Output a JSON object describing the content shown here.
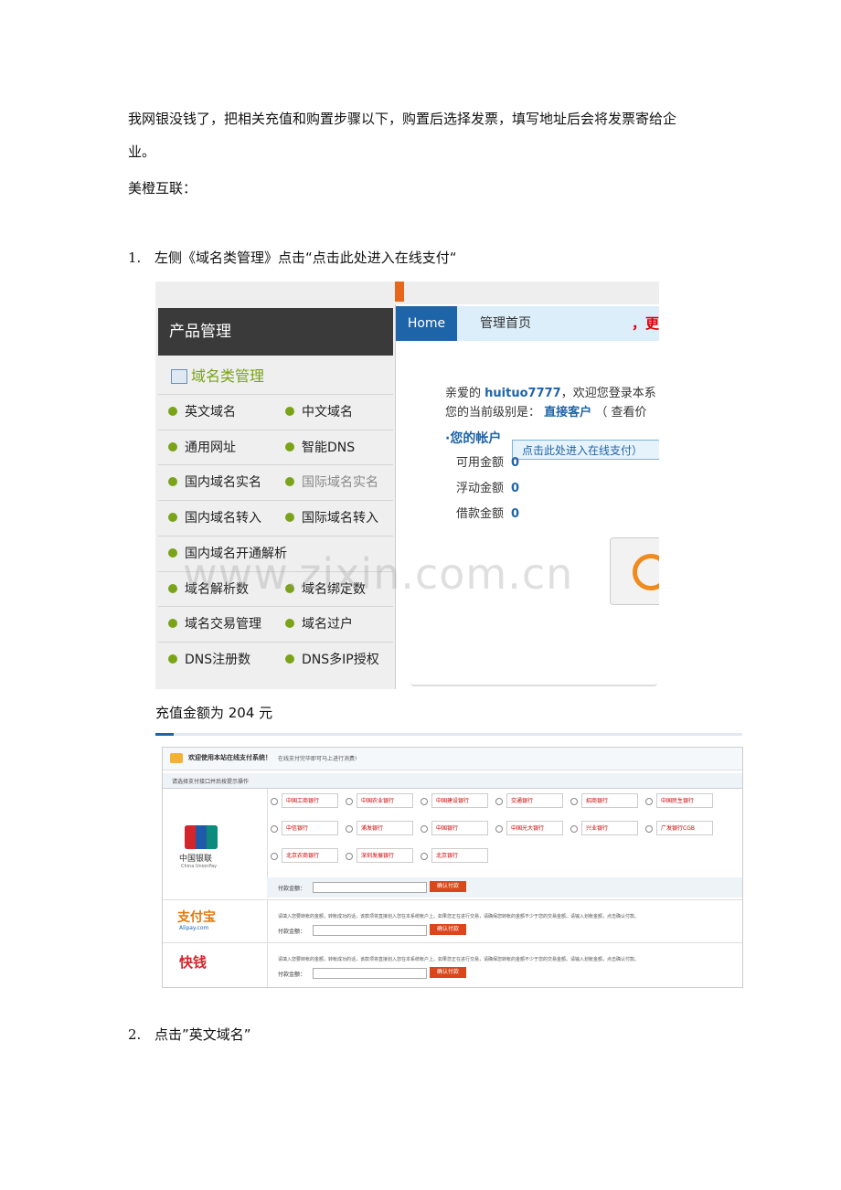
{
  "intro": {
    "line1": "我网银没钱了，把相关充值和购置步骤以下，购置后选择发票，填写地址后会将发票寄给企",
    "line2": "业。",
    "line3": "美橙互联："
  },
  "step1": {
    "num": "1.",
    "text": "左侧《域名类管理》点击“点击此处进入在线支付“"
  },
  "shot1": {
    "sidebar_title": "产品管理",
    "sidebar_sub": "域名类管理",
    "rows": [
      [
        "英文域名",
        "中文域名"
      ],
      [
        "通用网址",
        "智能DNS"
      ],
      [
        "国内域名实名",
        "国际域名实名"
      ],
      [
        "国内域名转入",
        "国际域名转入"
      ],
      [
        "国内域名开通解析",
        ""
      ],
      [
        "域名解析数",
        "域名绑定数"
      ],
      [
        "域名交易管理",
        "域名过户"
      ],
      [
        "DNS注册数",
        "DNS多IP授权"
      ]
    ],
    "home": "Home",
    "nav_tab": "管理首页",
    "nav_red": "，更",
    "greet_prefix": "亲爱的",
    "username": "huituo7777",
    "greet_suffix": "，欢迎您登录本系",
    "level_prefix": "您的当前级别是：",
    "level": "直接客户",
    "level_suffix": "（ 查看价",
    "account": "·您的帐户",
    "tip": "点击此处进入在线支付）",
    "balances": [
      {
        "label": "可用金额",
        "value": "0"
      },
      {
        "label": "浮动金额",
        "value": "0"
      },
      {
        "label": "借款金额",
        "value": "0"
      }
    ]
  },
  "watermark": "www.zixin.com.cn",
  "amount_text": "充值金额为 204 元",
  "shot2": {
    "head_title": "欢迎使用本站在线支付系统！",
    "head_sub": "在线支付完毕即可马上进行消费!",
    "sub": "请选择支付接口并后按提示操作",
    "unionpay": "中国银联",
    "unionpay_en": "China UnionPay",
    "banks": [
      "中国工商银行",
      "中国农业银行",
      "中国建设银行",
      "交通银行",
      "招商银行",
      "中国民生银行",
      "中信银行",
      "浦发银行",
      "中国银行",
      "中国光大银行",
      "兴业银行",
      "广发银行CGB",
      "北京农商银行",
      "深圳发展银行",
      "北京银行"
    ],
    "pay_label": "付款金额：",
    "confirm": "确认付款",
    "alipay": "支付宝",
    "alipay_sub": "Alipay.com",
    "kuaiqian": "快钱",
    "desc": "请填入您要转帐的金额，转帐成功的话，该款项将直接划入您在本系统帐户上。如果您正在进行交易，请确保您转帐的金额不少于您的交易金额。请输入划帐金额，点击确认付款。"
  },
  "step2": {
    "num": "2.",
    "text": "点击”英文域名”"
  }
}
